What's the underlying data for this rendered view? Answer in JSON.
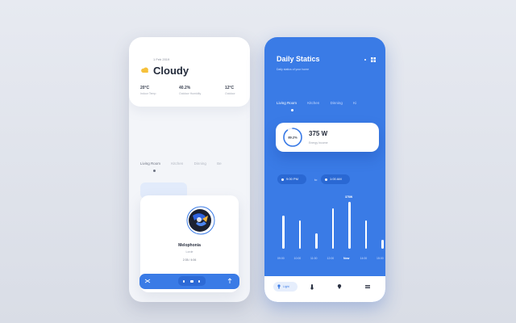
{
  "left_app": {
    "weather": {
      "date": "1 Feb 2019",
      "condition": "Cloudy",
      "stats": [
        {
          "value": "20°C",
          "label": "Indoor Temp"
        },
        {
          "value": "40.2%",
          "label": "Outdoor Humidity"
        },
        {
          "value": "12°C",
          "label": "Outdoor"
        }
      ]
    },
    "tabs": [
      "Living Room",
      "Kitchen",
      "Dinning",
      "Be"
    ],
    "music": {
      "title": "Melophonia",
      "artist": "Lorde",
      "time": "2:35 / 4:06"
    }
  },
  "right_app": {
    "title": "Daily Statics",
    "subtitle": "Daily statics of your home",
    "tabs": [
      "Living Room",
      "Kitchen",
      "Dinning",
      "Ki"
    ],
    "energy": {
      "percent": "89.2%",
      "value": "375 W",
      "label": "Energy Income"
    },
    "range": {
      "from": "9:00 PM",
      "to_word": "to",
      "to": "1:00 AM"
    },
    "chart_data": {
      "type": "bar",
      "categories": [
        "09:00",
        "10:00",
        "11:00",
        "12:00",
        "Now",
        "14:00",
        "15:00"
      ],
      "values": [
        30,
        25,
        14,
        36,
        42,
        25,
        8
      ],
      "peak_label": "375W",
      "highlighted": "Now"
    },
    "nav": {
      "light_label": "Light"
    }
  },
  "colors": {
    "accent": "#3a7be6",
    "dark_blue": "#2a68d3",
    "text_dark": "#222a3a"
  }
}
